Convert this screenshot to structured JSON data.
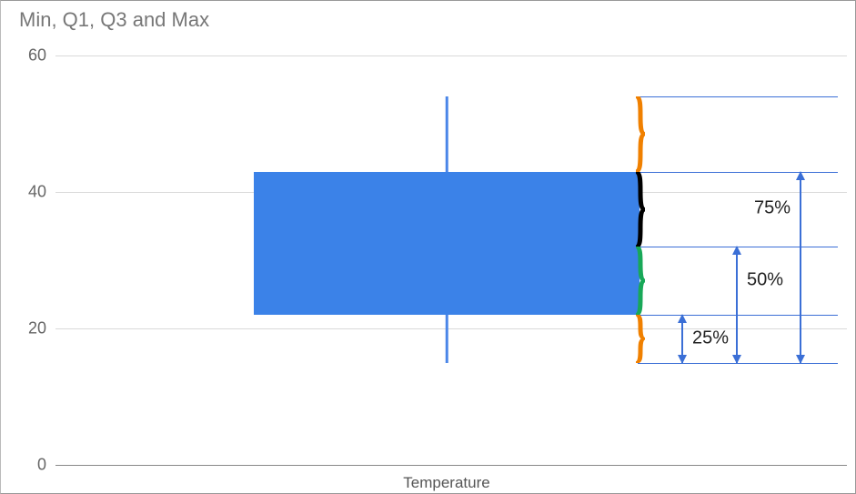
{
  "title": "Min, Q1, Q3 and Max",
  "yticks": {
    "t0": "0",
    "t20": "20",
    "t40": "40",
    "t60": "60"
  },
  "xlabel": "Temperature",
  "annotations": {
    "p25": "25%",
    "p50": "50%",
    "p75": "75%"
  },
  "chart_data": {
    "type": "boxplot",
    "title": "Min, Q1, Q3 and Max",
    "xlabel": "Temperature",
    "ylabel": "",
    "ylim": [
      0,
      60
    ],
    "yticks": [
      0,
      20,
      40,
      60
    ],
    "categories": [
      "Temperature"
    ],
    "series": [
      {
        "name": "Temperature",
        "min": 15,
        "q1": 22,
        "median": 32,
        "q3": 43,
        "max": 54
      }
    ],
    "quartile_annotations": [
      {
        "span": "min→q1",
        "label": "25%"
      },
      {
        "span": "min→median",
        "label": "50%"
      },
      {
        "span": "min→q3",
        "label": "75%"
      }
    ]
  }
}
